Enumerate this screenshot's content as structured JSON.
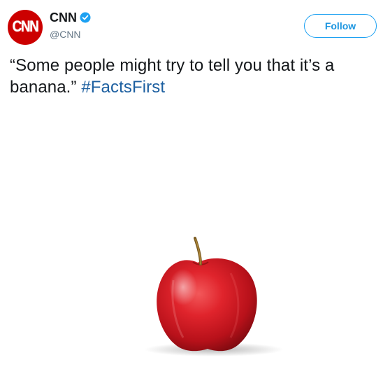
{
  "tweet": {
    "author": {
      "avatar_text": "CNN",
      "display_name": "CNN",
      "handle": "@CNN",
      "verified": true
    },
    "follow_label": "Follow",
    "text_before_hashtag": "“Some people might try to tell you that it’s a banana.” ",
    "hashtag": "#FactsFirst",
    "media": {
      "subject": "apple"
    }
  },
  "colors": {
    "brand_red": "#cc0000",
    "link_blue": "#1c5fa0",
    "follow_blue": "#1da1f2",
    "verified_blue": "#1da1f2",
    "secondary_text": "#657786"
  }
}
